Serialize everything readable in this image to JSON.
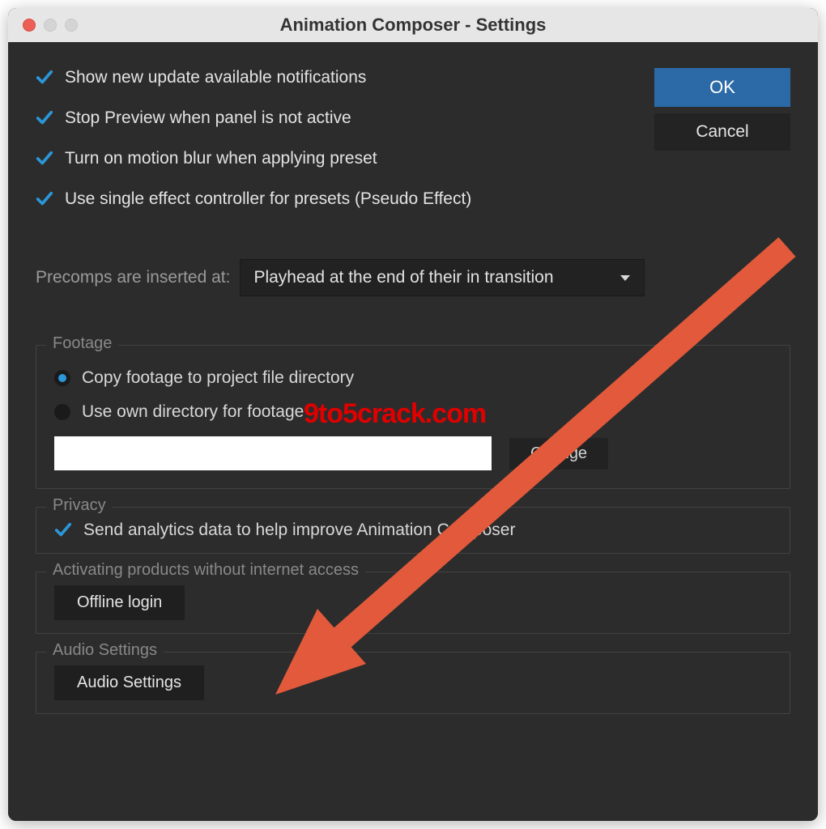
{
  "window": {
    "title": "Animation Composer - Settings"
  },
  "buttons": {
    "ok": "OK",
    "cancel": "Cancel",
    "change": "Change",
    "offline": "Offline login",
    "audio": "Audio Settings"
  },
  "checks": {
    "updates": "Show new update available notifications",
    "preview": "Stop Preview when panel is not active",
    "motionblur": "Turn on motion blur when applying preset",
    "pseudo": "Use single effect controller for presets (Pseudo Effect)"
  },
  "precomp": {
    "label": "Precomps are inserted at:",
    "selected": "Playhead at the end of their in transition"
  },
  "footage": {
    "group": "Footage",
    "copy": "Copy footage to project file directory",
    "own": "Use own directory for footage",
    "path": ""
  },
  "privacy": {
    "group": "Privacy",
    "analytics": "Send analytics data to help improve Animation Composer"
  },
  "activating": {
    "group": "Activating products without internet access"
  },
  "audio": {
    "group": "Audio Settings"
  },
  "annotation": {
    "watermark": "9to5crack.com"
  }
}
